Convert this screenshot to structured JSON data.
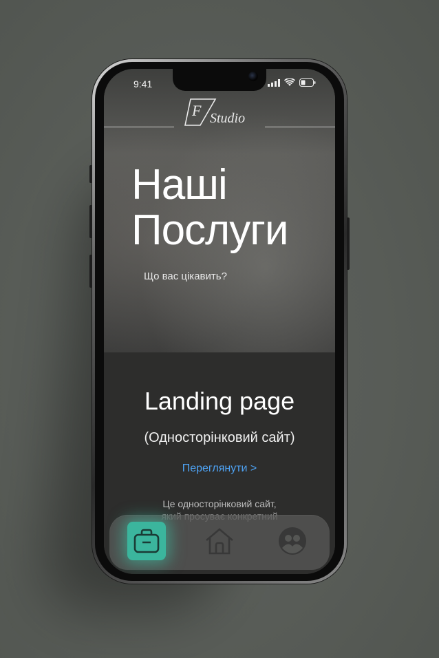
{
  "status_bar": {
    "time": "9:41"
  },
  "brand": {
    "logo_letter": "F",
    "logo_text": "Studio"
  },
  "hero": {
    "title_line1": "Наші",
    "title_line2": "Послуги",
    "subtitle": "Що вас цікавить?"
  },
  "service_card": {
    "title": "Landing page",
    "subtitle": "(Односторінковий сайт)",
    "link_label": "Переглянути >",
    "description_line1": "Це односторінковий сайт,",
    "description_line2": "який просуває конкретний"
  },
  "bottom_nav": {
    "items": [
      {
        "icon": "briefcase-icon",
        "active": true
      },
      {
        "icon": "home-icon",
        "active": false
      },
      {
        "icon": "people-icon",
        "active": false
      }
    ],
    "accent_color": "#3bb59d"
  },
  "colors": {
    "link": "#4ea3f5",
    "background": "#585c57"
  }
}
